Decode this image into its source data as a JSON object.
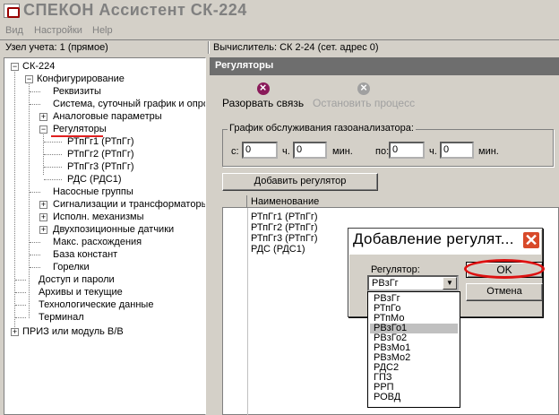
{
  "window": {
    "title": "СПЕКОН Ассистент СК-224"
  },
  "menu": [
    "Вид",
    "Настройки",
    "Help"
  ],
  "status": {
    "left": "Узел учета: 1 (прямое)",
    "right": "Вычислитель: СК 2-24 (сет. адрес 0)"
  },
  "tree": {
    "root": "СК-224",
    "config": "Конфигурирование",
    "items": {
      "requisites": "Реквизиты",
      "system": "Система, суточный график и опросс",
      "analog": "Аналоговые параметры",
      "regulators": "Регуляторы",
      "r1": "РТпГг1 (РТпГг)",
      "r2": "РТпГг2 (РТпГг)",
      "r3": "РТпГг3 (РТпГг)",
      "rds": "РДС (РДС1)",
      "pumps": "Насосные группы",
      "signals": "Сигнализации и трансформаторы",
      "exec": "Исполн. механизмы",
      "twopos": "Двухпозиционные датчики",
      "maxdiff": "Макс. расхождения",
      "constbase": "База констант",
      "burners": "Горелки"
    },
    "access": "Доступ и пароли",
    "archives": "Архивы и текущие",
    "techdata": "Технологические данные",
    "terminal": "Терминал",
    "priz": "ПРИЗ или модуль В/В"
  },
  "panel": {
    "title": "Регуляторы",
    "break_label": "Разорвать связь",
    "stop_label": "Остановить процесс",
    "group_label": "График обслуживания газоанализатора:",
    "from_label": "с:",
    "to_label": "по:",
    "h_label": "ч.",
    "min_label": "мин.",
    "from_h": "0",
    "from_m": "0",
    "to_h": "0",
    "to_m": "0",
    "add_button": "Добавить регулятор",
    "grid_header": "Наименование",
    "rows": [
      "РТпГг1 (РТпГг)",
      "РТпГг2 (РТпГг)",
      "РТпГг3 (РТпГг)",
      "РДС (РДС1)"
    ]
  },
  "dialog": {
    "title": "Добавление регулят...",
    "close": "✕",
    "reg_label": "Регулятор:",
    "selected": "РВзГг",
    "ok": "OK",
    "cancel": "Отмена",
    "options": [
      "РВзГг",
      "РТпГо",
      "РТпМо",
      "РВзГо1",
      "РВзГо2",
      "РВзМо1",
      "РВзМо2",
      "РДС2",
      "ГПЗ",
      "РРП",
      "РОВД"
    ],
    "highlighted_option": "РВзГо1"
  },
  "colors": {
    "accent_red": "#e02020",
    "panel_header": "#6e6e6e",
    "break_icon": "#8a1a5a",
    "stop_icon": "#a0a0a0"
  }
}
